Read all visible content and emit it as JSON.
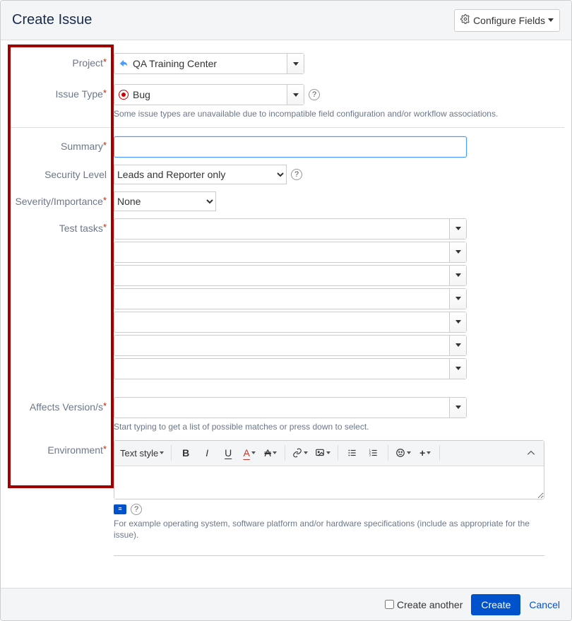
{
  "header": {
    "title": "Create Issue",
    "configure_label": "Configure Fields"
  },
  "fields": {
    "project": {
      "label": "Project",
      "value": "QA Training Center"
    },
    "issue_type": {
      "label": "Issue Type",
      "value": "Bug",
      "hint": "Some issue types are unavailable due to incompatible field configuration and/or workflow associations."
    },
    "summary": {
      "label": "Summary",
      "value": ""
    },
    "security_level": {
      "label": "Security Level",
      "value": "Leads and Reporter only"
    },
    "severity": {
      "label": "Severity/Importance",
      "value": "None"
    },
    "test_tasks": {
      "label": "Test tasks",
      "rows": [
        "",
        "",
        "",
        "",
        "",
        "",
        ""
      ]
    },
    "affects_versions": {
      "label": "Affects Version/s",
      "value": "",
      "hint": "Start typing to get a list of possible matches or press down to select."
    },
    "environment": {
      "label": "Environment",
      "hint": "For example operating system, software platform and/or hardware specifications (include as appropriate for the issue)."
    }
  },
  "rte": {
    "text_style": "Text style"
  },
  "footer": {
    "create_another": "Create another",
    "create": "Create",
    "cancel": "Cancel"
  }
}
